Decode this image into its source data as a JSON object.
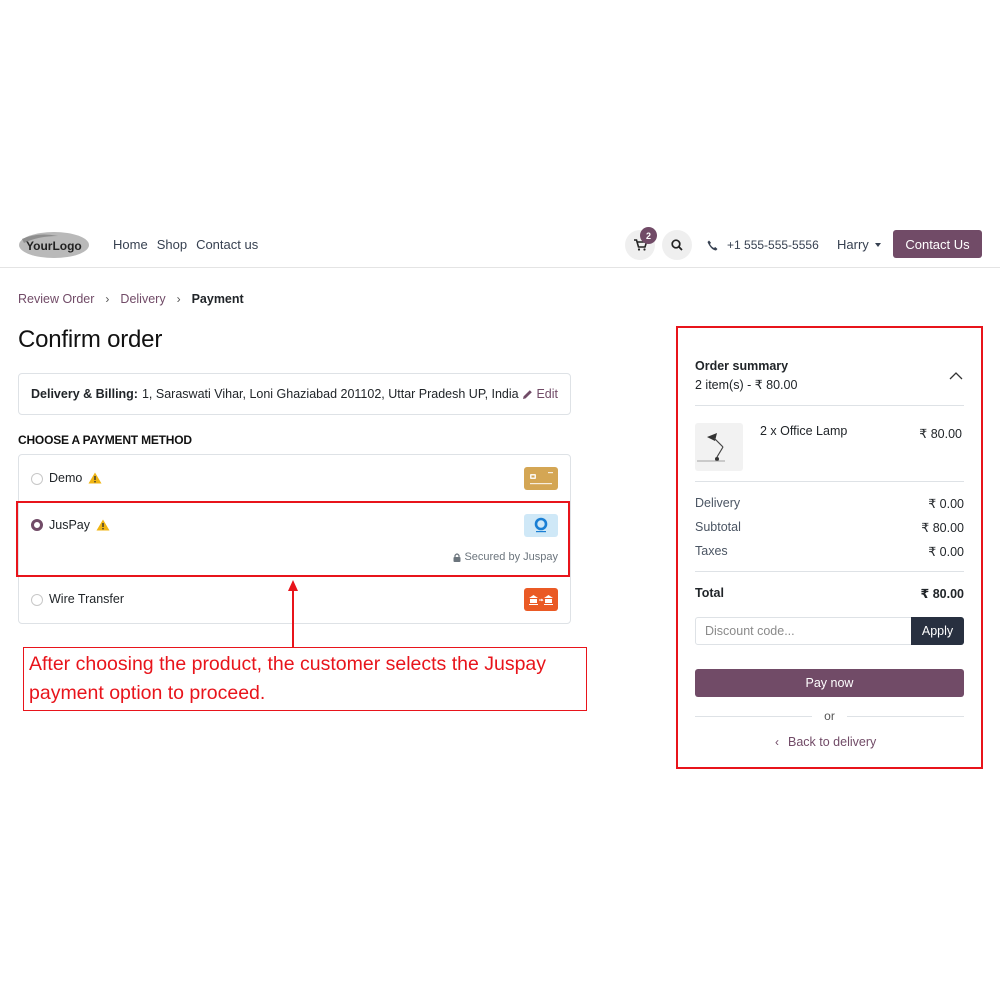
{
  "header": {
    "logo_text": "YourLogo",
    "nav": [
      "Home",
      "Shop",
      "Contact us"
    ],
    "cart_count": "2",
    "phone": "+1 555-555-5556",
    "user": "Harry",
    "contact_button": "Contact Us"
  },
  "breadcrumb": {
    "step1": "Review Order",
    "step2": "Delivery",
    "step3": "Payment"
  },
  "page_title": "Confirm order",
  "address": {
    "label": "Delivery & Billing:",
    "value": "1, Saraswati Vihar, Loni Ghaziabad 201102, Uttar Pradesh UP, India",
    "edit": "Edit"
  },
  "payment": {
    "section_title": "CHOOSE A PAYMENT METHOD",
    "methods": [
      {
        "label": "Demo",
        "selected": false
      },
      {
        "label": "JusPay",
        "selected": true,
        "note": "Secured by Juspay"
      },
      {
        "label": "Wire Transfer",
        "selected": false
      }
    ]
  },
  "annotation": {
    "text": "After choosing the product, the customer selects the Juspay payment option to proceed."
  },
  "summary": {
    "title": "Order summary",
    "count": "2 item(s) -  ₹ 80.00",
    "product_name": "2 x Office Lamp",
    "product_price": "₹ 80.00",
    "delivery_label": "Delivery",
    "delivery_value": "₹ 0.00",
    "subtotal_label": "Subtotal",
    "subtotal_value": "₹ 80.00",
    "taxes_label": "Taxes",
    "taxes_value": "₹ 0.00",
    "total_label": "Total",
    "total_value": "₹ 80.00",
    "discount_placeholder": "Discount code...",
    "apply": "Apply",
    "pay_now": "Pay now",
    "or": "or",
    "back": "Back to delivery"
  },
  "colors": {
    "accent": "#714b67",
    "annotation": "#e8141b",
    "dark_button": "#283040"
  }
}
